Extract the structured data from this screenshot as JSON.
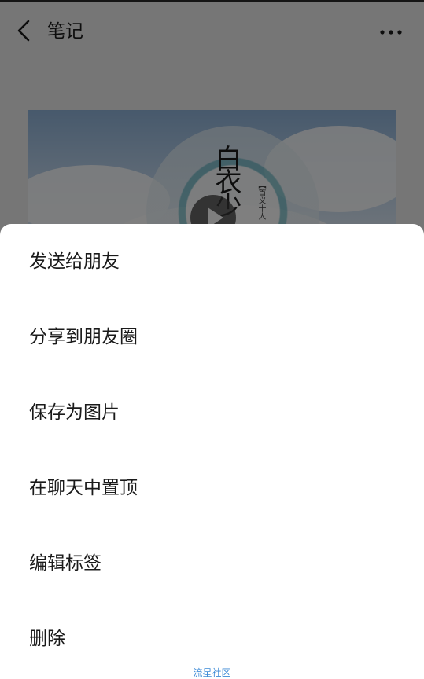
{
  "header": {
    "back_icon": "chevron-left-icon",
    "title": "笔记",
    "more_icon": "more-horizontal-icon"
  },
  "cover": {
    "calligraphy": "白衣少",
    "caption": "【首义十人",
    "play_icon": "play-icon"
  },
  "action_sheet": {
    "items": [
      {
        "label": "发送给朋友"
      },
      {
        "label": "分享到朋友圈"
      },
      {
        "label": "保存为图片"
      },
      {
        "label": "在聊天中置顶"
      },
      {
        "label": "编辑标签"
      },
      {
        "label": "删除"
      }
    ]
  },
  "watermark": "流星社区",
  "colors": {
    "background": "#ededed",
    "sheet": "#ffffff",
    "overlay": "rgba(0,0,0,0.5)",
    "watermark": "#3c8ad6"
  }
}
